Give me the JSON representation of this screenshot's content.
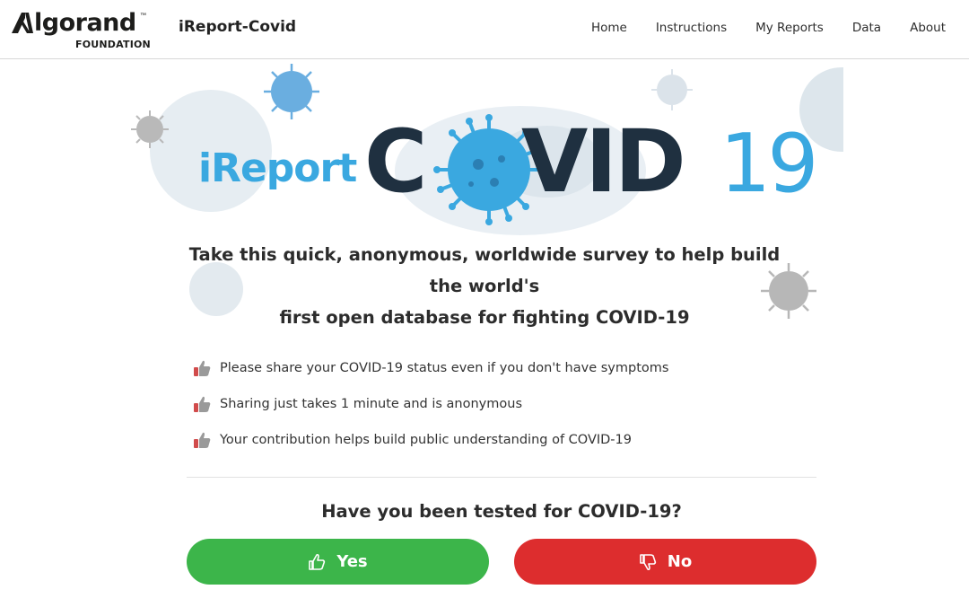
{
  "header": {
    "logo": {
      "word": "lgorand",
      "tm": "™",
      "sub": "FOUNDATION"
    },
    "app_title": "iReport-Covid",
    "nav": [
      "Home",
      "Instructions",
      "My Reports",
      "Data",
      "About"
    ]
  },
  "hero": {
    "ireport": "iReport",
    "c": "C",
    "vid": "VID",
    "num": "19"
  },
  "headline": {
    "line1": "Take this quick, anonymous, worldwide survey to help build the world's",
    "line2": "first open database for fighting COVID-19"
  },
  "bullets": [
    {
      "icon": "thumbs-up-icon",
      "text": "Please share your COVID-19 status even if you don't have symptoms"
    },
    {
      "icon": "thumbs-up-icon",
      "text": "Sharing just takes 1 minute and is anonymous"
    },
    {
      "icon": "thumbs-up-icon",
      "text": "Your contribution helps build public understanding of COVID-19"
    }
  ],
  "question": "Have you been tested for COVID-19?",
  "buttons": {
    "yes": {
      "label": "Yes",
      "icon": "thumbs-up-icon",
      "color": "#3cb54a"
    },
    "no": {
      "label": "No",
      "icon": "thumbs-down-icon",
      "color": "#dd2d2e"
    }
  },
  "colors": {
    "brand_blue": "#3aa8e0",
    "brand_dark": "#1f3040"
  }
}
